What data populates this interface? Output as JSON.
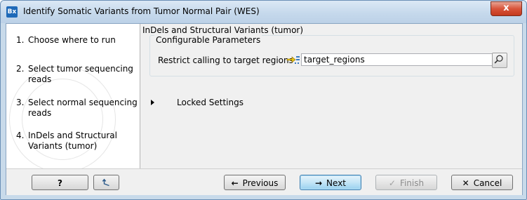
{
  "window": {
    "title": "Identify Somatic Variants from Tumor Normal Pair (WES)",
    "app_icon_text": "Bx",
    "close_symbol": "x"
  },
  "steps": [
    {
      "number": "1.",
      "label": "Choose where to run"
    },
    {
      "number": "2.",
      "label": "Select tumor sequencing reads"
    },
    {
      "number": "3.",
      "label": "Select normal sequencing reads"
    },
    {
      "number": "4.",
      "label": "InDels and Structural Variants (tumor)"
    }
  ],
  "panel": {
    "title": "InDels and Structural Variants (tumor)",
    "group_legend": "Configurable Parameters",
    "param_label": "Restrict calling to target regions",
    "param_value": "target_regions",
    "locked_label": "Locked Settings"
  },
  "footer": {
    "help_label": "?",
    "previous_label": "Previous",
    "next_label": "Next",
    "finish_label": "Finish",
    "cancel_label": "Cancel"
  },
  "colors": {
    "title_gradient": "#c6d9ec",
    "close_red": "#d8543a",
    "focused_button": "#98d1ef"
  },
  "icons": {
    "back_icon": "reset-arrow-icon",
    "previous_icon": "left-arrow-icon",
    "next_icon": "right-arrow-icon",
    "finish_icon": "checkmark-icon",
    "cancel_icon": "x-icon",
    "browse_icon": "magnifier-icon",
    "target_icon": "target-regions-icon"
  }
}
